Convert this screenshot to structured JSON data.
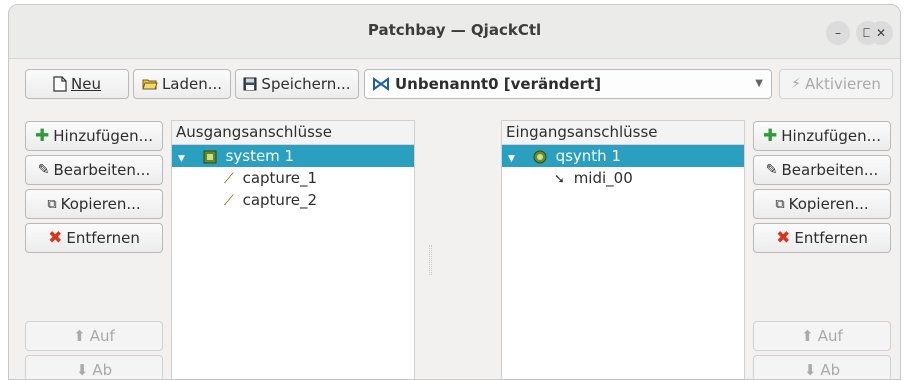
{
  "window": {
    "title": "Patchbay — QjackCtl"
  },
  "toolbar": {
    "new_label": "Neu",
    "load_label": "Laden...",
    "save_label": "Speichern...",
    "patchbay_name": "Unbenannt0 [verändert]",
    "activate_label": "Aktivieren"
  },
  "left_buttons": {
    "add": "Hinzufügen...",
    "edit": "Bearbeiten...",
    "copy": "Kopieren...",
    "remove": "Entfernen",
    "up": "Auf",
    "down": "Ab"
  },
  "right_buttons": {
    "add": "Hinzufügen...",
    "edit": "Bearbeiten...",
    "copy": "Kopieren...",
    "remove": "Entfernen",
    "up": "Auf",
    "down": "Ab"
  },
  "outputs": {
    "header": "Ausgangsanschlüsse",
    "client": "system 1",
    "ports": [
      "capture_1",
      "capture_2"
    ]
  },
  "inputs": {
    "header": "Eingangsanschlüsse",
    "client": "qsynth 1",
    "ports": [
      "midi_00"
    ]
  },
  "colors": {
    "selection": "#2a9fc0",
    "add_icon": "#2a9d3a",
    "remove_icon": "#d8351c"
  }
}
